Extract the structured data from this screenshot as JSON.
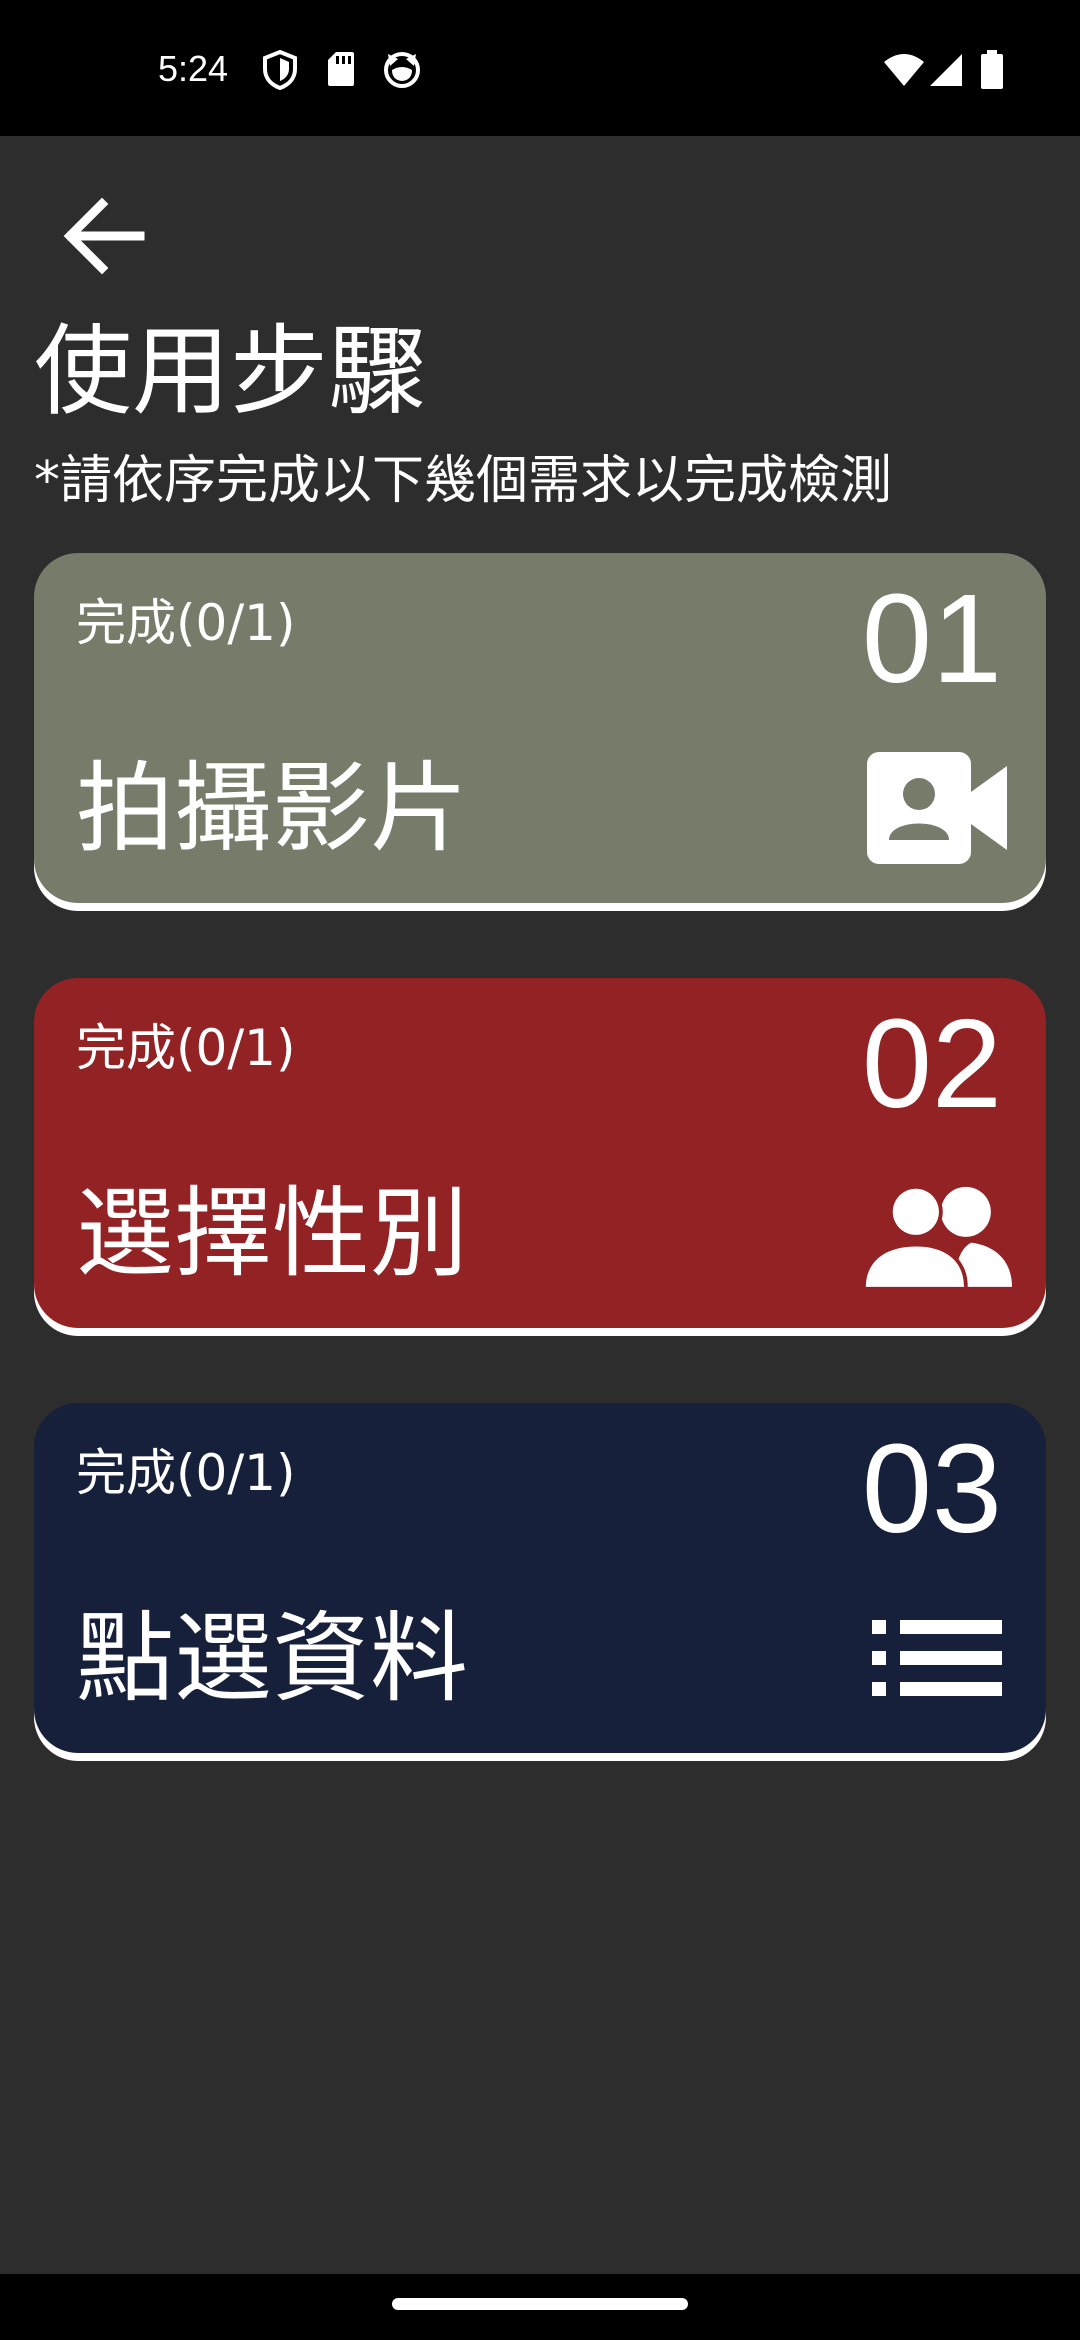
{
  "status_bar": {
    "time": "5:24",
    "left_icons": [
      "shield-icon",
      "sd-card-icon",
      "cat-face-icon"
    ],
    "right_icons": [
      "wifi-icon",
      "cellular-signal-icon",
      "battery-icon"
    ]
  },
  "header": {
    "back_icon": "arrow-left-icon",
    "title": "使用步驟",
    "subtitle": "*請依序完成以下幾個需求以完成檢測"
  },
  "steps": [
    {
      "status": "完成(0/1)",
      "number": "01",
      "label": "拍攝影片",
      "icon": "video-camera-icon",
      "color": "#777b6a"
    },
    {
      "status": "完成(0/1)",
      "number": "02",
      "label": "選擇性別",
      "icon": "users-icon",
      "color": "#932224"
    },
    {
      "status": "完成(0/1)",
      "number": "03",
      "label": "點選資料",
      "icon": "list-icon",
      "color": "#16203a"
    }
  ],
  "colors": {
    "background": "#2d2d2d",
    "system_bars": "#000000",
    "text": "#ffffff"
  }
}
